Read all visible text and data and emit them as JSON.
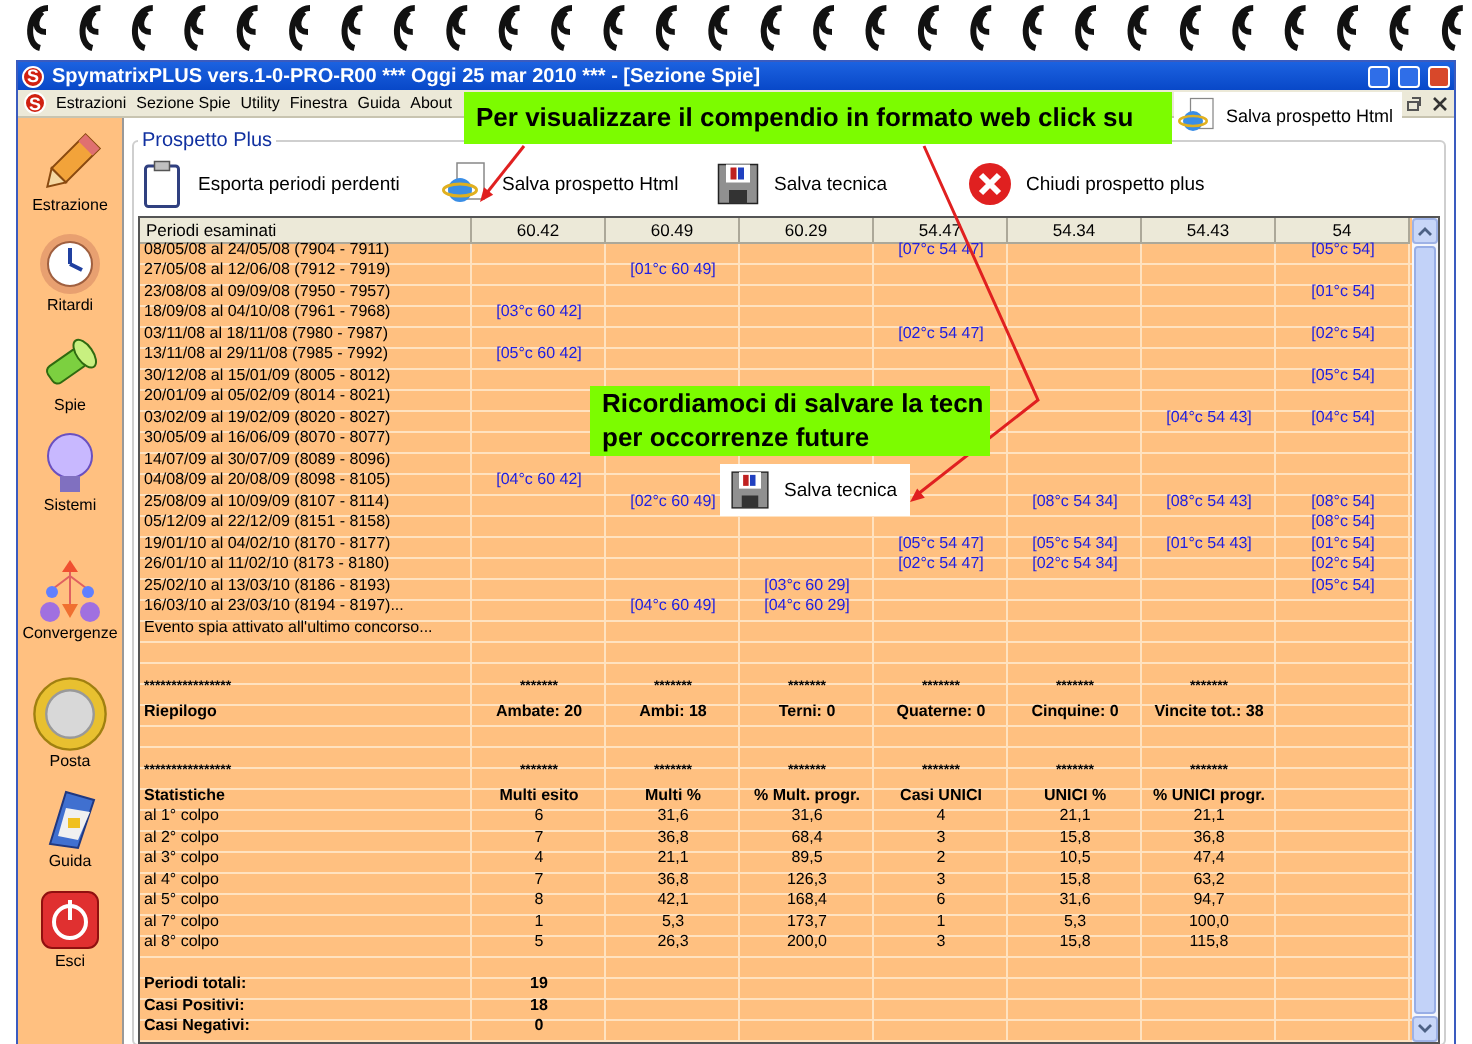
{
  "window": {
    "icon_letter": "S",
    "title": "SpymatrixPLUS vers.1-0-PRO-R00 *** Oggi 25 mar 2010 *** - [Sezione Spie]"
  },
  "menu": {
    "icon_letter": "S",
    "items": [
      "Estrazioni",
      "Sezione Spie",
      "Utility",
      "Finestra",
      "Guida",
      "About"
    ]
  },
  "sidebar": [
    {
      "label": "Estrazione",
      "kind": "pencil"
    },
    {
      "label": "Ritardi",
      "kind": "clock"
    },
    {
      "label": "Spie",
      "kind": "flashlight"
    },
    {
      "label": "Sistemi",
      "kind": "bulb"
    },
    {
      "label": "Convergenze",
      "kind": "diagram"
    },
    {
      "label": "Posta",
      "kind": "coin"
    },
    {
      "label": "Guida",
      "kind": "folder"
    },
    {
      "label": "Esci",
      "kind": "power"
    }
  ],
  "panel": {
    "title": "Prospetto Plus",
    "toolbar": [
      {
        "label": "Esporta periodi perdenti",
        "kind": "clipboard"
      },
      {
        "label": "Salva prospetto Html",
        "kind": "web"
      },
      {
        "label": "Salva tecnica",
        "kind": "floppy"
      },
      {
        "label": "Chiudi prospetto plus",
        "kind": "close"
      }
    ]
  },
  "table": {
    "columns": [
      "Periodi esaminati",
      "60.42",
      "60.49",
      "60.29",
      "54.47",
      "54.34",
      "54.43",
      "54"
    ],
    "rows": [
      {
        "kind": "period",
        "cells": [
          "08/05/08 al 24/05/08  (7904 - 7911)",
          null,
          null,
          null,
          "[07°c 54 47]",
          null,
          null,
          "[05°c 54]"
        ]
      },
      {
        "kind": "period",
        "cells": [
          "27/05/08 al 12/06/08  (7912 - 7919)",
          null,
          "[01°c 60 49]",
          null,
          null,
          null,
          null,
          null
        ]
      },
      {
        "kind": "period",
        "cells": [
          "23/08/08 al 09/09/08  (7950 - 7957)",
          null,
          null,
          null,
          null,
          null,
          null,
          "[01°c 54]"
        ]
      },
      {
        "kind": "period",
        "cells": [
          "18/09/08 al 04/10/08  (7961 - 7968)",
          "[03°c 60 42]",
          null,
          null,
          null,
          null,
          null,
          null
        ]
      },
      {
        "kind": "period",
        "cells": [
          "03/11/08 al 18/11/08  (7980 - 7987)",
          null,
          null,
          null,
          "[02°c 54 47]",
          null,
          null,
          "[02°c 54]"
        ]
      },
      {
        "kind": "period",
        "cells": [
          "13/11/08 al 29/11/08  (7985 - 7992)",
          "[05°c 60 42]",
          null,
          null,
          null,
          null,
          null,
          null
        ]
      },
      {
        "kind": "period",
        "cells": [
          "30/12/08 al 15/01/09  (8005 - 8012)",
          null,
          null,
          null,
          null,
          null,
          null,
          "[05°c 54]"
        ]
      },
      {
        "kind": "period",
        "cells": [
          "20/01/09 al 05/02/09  (8014 - 8021)",
          null,
          null,
          null,
          null,
          null,
          null,
          null
        ]
      },
      {
        "kind": "period",
        "cells": [
          "03/02/09 al 19/02/09  (8020 - 8027)",
          null,
          null,
          null,
          null,
          null,
          "[04°c 54 43]",
          "[04°c 54]"
        ]
      },
      {
        "kind": "period",
        "cells": [
          "30/05/09 al 16/06/09  (8070 - 8077)",
          null,
          null,
          null,
          null,
          null,
          null,
          null
        ]
      },
      {
        "kind": "period",
        "cells": [
          "14/07/09 al 30/07/09  (8089 - 8096)",
          null,
          null,
          null,
          null,
          null,
          null,
          null
        ]
      },
      {
        "kind": "period",
        "cells": [
          "04/08/09 al 20/08/09  (8098 - 8105)",
          "[04°c 60 42]",
          null,
          null,
          null,
          null,
          null,
          null
        ]
      },
      {
        "kind": "period",
        "cells": [
          "25/08/09 al 10/09/09  (8107 - 8114)",
          null,
          "[02°c 60 49]",
          null,
          null,
          "[08°c 54 34]",
          "[08°c 54 43]",
          "[08°c 54]"
        ]
      },
      {
        "kind": "period",
        "cells": [
          "05/12/09 al 22/12/09  (8151 - 8158)",
          null,
          null,
          null,
          null,
          null,
          null,
          "[08°c 54]"
        ]
      },
      {
        "kind": "period",
        "cells": [
          "19/01/10 al 04/02/10  (8170 - 8177)",
          null,
          null,
          null,
          "[05°c 54 47]",
          "[05°c 54 34]",
          "[01°c 54 43]",
          "[01°c 54]"
        ]
      },
      {
        "kind": "period",
        "cells": [
          "26/01/10 al 11/02/10  (8173 - 8180)",
          null,
          null,
          null,
          "[02°c 54 47]",
          "[02°c 54 34]",
          null,
          "[02°c 54]"
        ]
      },
      {
        "kind": "period",
        "cells": [
          "25/02/10 al 13/03/10  (8186 - 8193)",
          null,
          null,
          "[03°c 60 29]",
          null,
          null,
          null,
          "[05°c 54]"
        ]
      },
      {
        "kind": "period",
        "cells": [
          "16/03/10 al 23/03/10  (8194 - 8197)...",
          null,
          "[04°c 60 49]",
          "[04°c 60 29]",
          null,
          null,
          null,
          null
        ]
      },
      {
        "kind": "note",
        "cells": [
          "Evento spia attivato all'ultimo concorso...",
          null,
          null,
          null,
          null,
          null,
          null,
          null
        ]
      },
      {
        "kind": "blank"
      },
      {
        "kind": "blank"
      },
      {
        "kind": "separator",
        "cells": [
          "****************",
          "*******",
          "*******",
          "*******",
          "*******",
          "*******",
          "*******",
          null
        ]
      },
      {
        "kind": "heading",
        "cells": [
          "Riepilogo",
          "Ambate: 20",
          "Ambi: 18",
          "Terni: 0",
          "Quaterne: 0",
          "Cinquine: 0",
          "Vincite tot.: 38",
          null
        ]
      },
      {
        "kind": "blank"
      },
      {
        "kind": "blank"
      },
      {
        "kind": "separator",
        "cells": [
          "****************",
          "*******",
          "*******",
          "*******",
          "*******",
          "*******",
          "*******",
          null
        ]
      },
      {
        "kind": "heading",
        "cells": [
          "Statistiche",
          "Multi esito",
          "Multi %",
          "% Mult. progr.",
          "Casi UNICI",
          "UNICI %",
          "% UNICI progr.",
          null
        ]
      },
      {
        "kind": "stat",
        "cells": [
          "al 1° colpo",
          "6",
          "31,6",
          "31,6",
          "4",
          "21,1",
          "21,1",
          null
        ]
      },
      {
        "kind": "stat",
        "cells": [
          "al 2° colpo",
          "7",
          "36,8",
          "68,4",
          "3",
          "15,8",
          "36,8",
          null
        ]
      },
      {
        "kind": "stat",
        "cells": [
          "al 3° colpo",
          "4",
          "21,1",
          "89,5",
          "2",
          "10,5",
          "47,4",
          null
        ]
      },
      {
        "kind": "stat",
        "cells": [
          "al 4° colpo",
          "7",
          "36,8",
          "126,3",
          "3",
          "15,8",
          "63,2",
          null
        ]
      },
      {
        "kind": "stat",
        "cells": [
          "al 5° colpo",
          "8",
          "42,1",
          "168,4",
          "6",
          "31,6",
          "94,7",
          null
        ]
      },
      {
        "kind": "stat",
        "cells": [
          "al 7° colpo",
          "1",
          "5,3",
          "173,7",
          "1",
          "5,3",
          "100,0",
          null
        ]
      },
      {
        "kind": "stat",
        "cells": [
          "al 8° colpo",
          "5",
          "26,3",
          "200,0",
          "3",
          "15,8",
          "115,8",
          null
        ]
      },
      {
        "kind": "blank"
      },
      {
        "kind": "heading",
        "cells": [
          "Periodi totali:",
          "19",
          null,
          null,
          null,
          null,
          null,
          null
        ]
      },
      {
        "kind": "heading",
        "cells": [
          "Casi Positivi:",
          "18",
          null,
          null,
          null,
          null,
          null,
          null
        ]
      },
      {
        "kind": "heading",
        "cells": [
          "Casi Negativi:",
          "0",
          null,
          null,
          null,
          null,
          null,
          null
        ]
      }
    ]
  },
  "callouts": [
    {
      "lines": [
        "Per visualizzare il compendio in formato web click su"
      ],
      "button": {
        "label": "Salva prospetto Html",
        "kind": "web"
      }
    },
    {
      "lines": [
        "Ricordiamoci di salvare la tecn",
        "per occorrenze future"
      ],
      "button": {
        "label": "Salva tecnica",
        "kind": "floppy"
      }
    }
  ]
}
